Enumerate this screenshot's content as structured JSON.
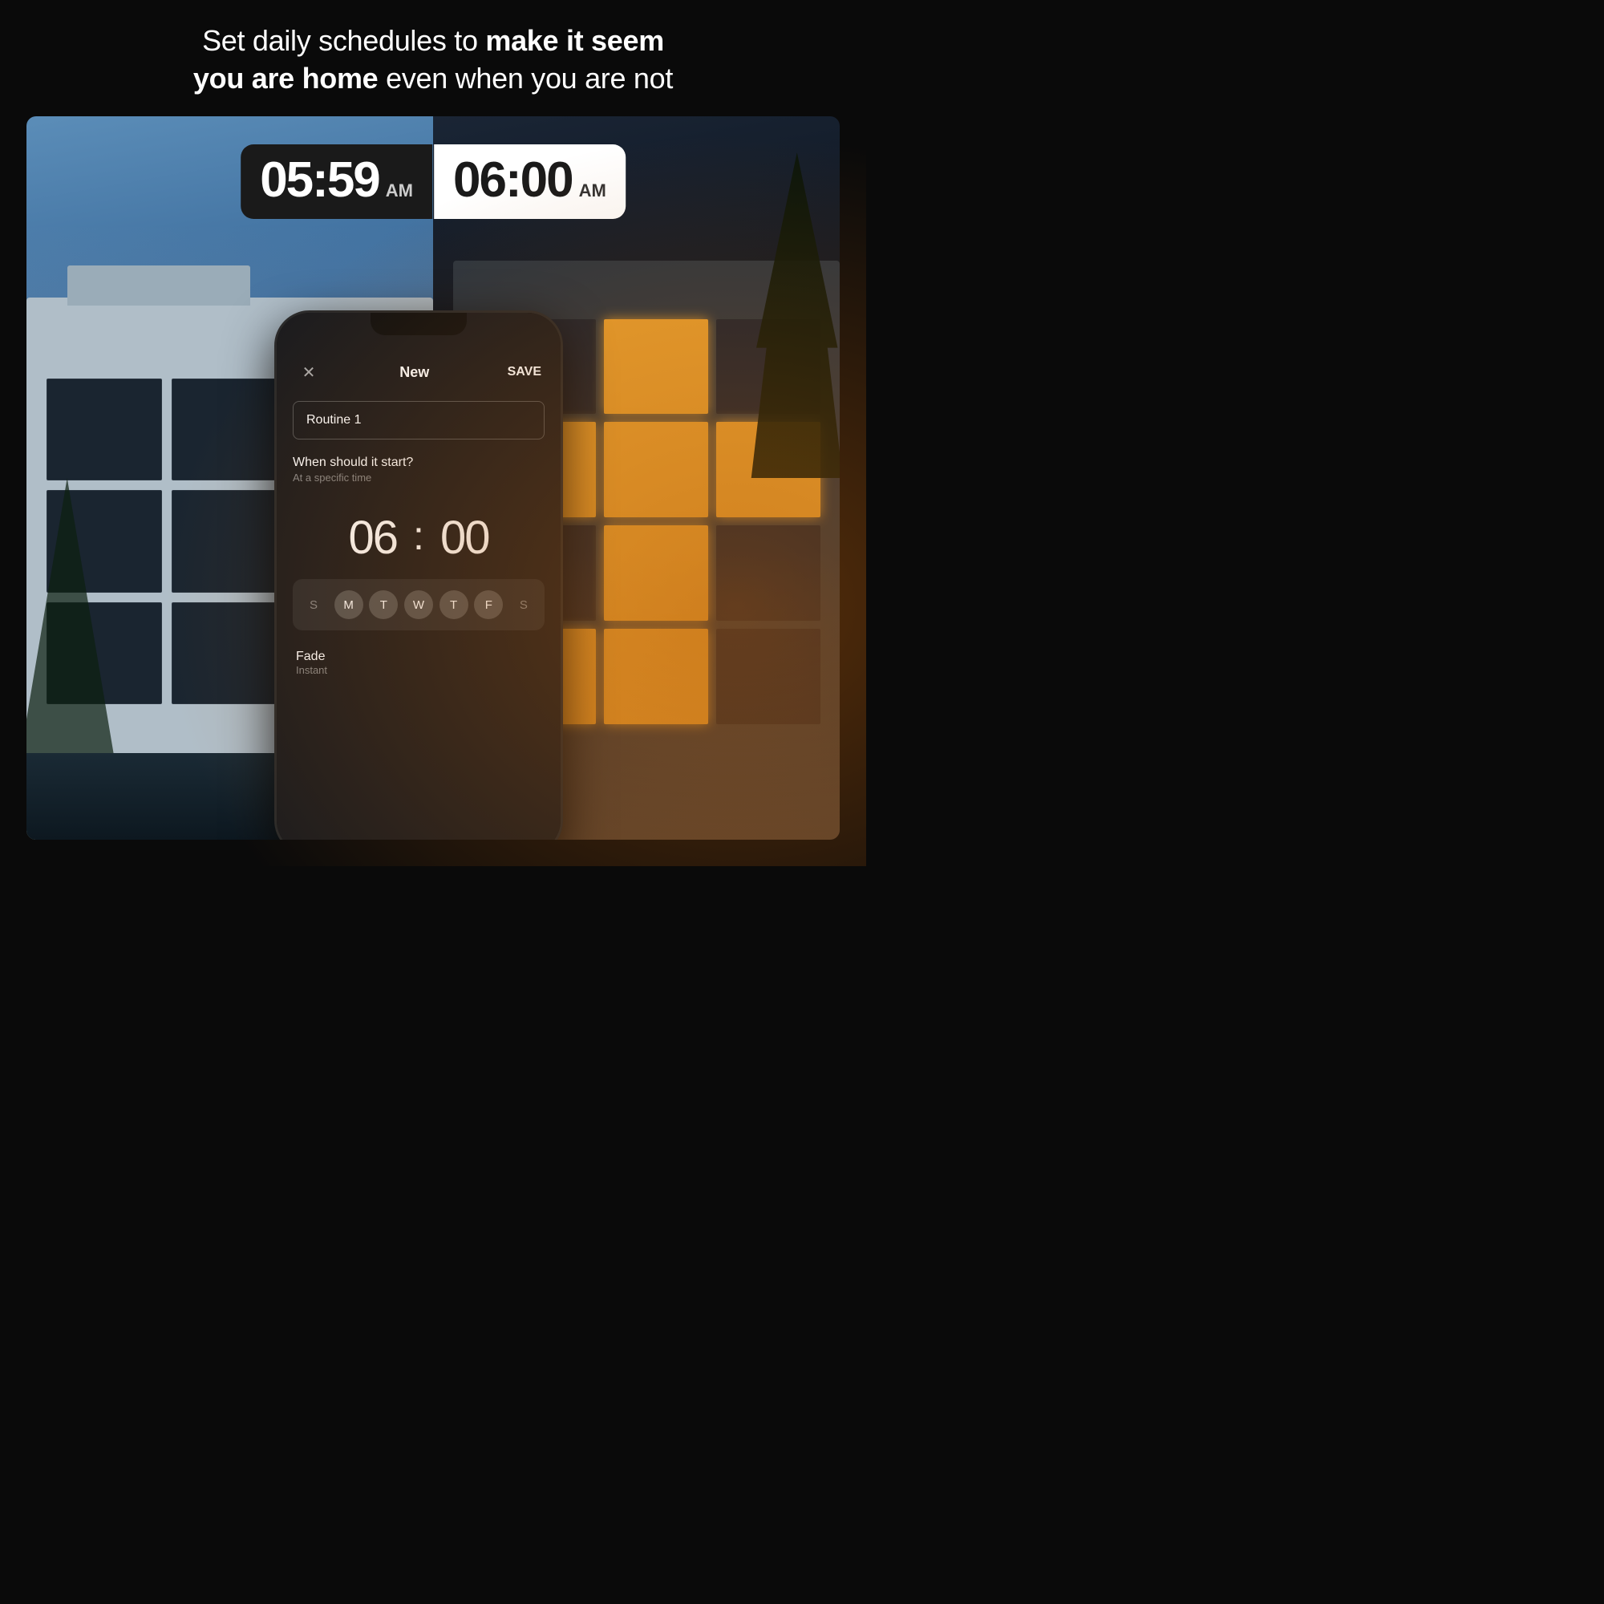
{
  "header": {
    "line1_normal": "Set daily schedules to ",
    "line1_bold": "make it seem",
    "line2_bold": "you are home",
    "line2_normal": " even when you are not"
  },
  "time_display": {
    "left_time": "05:59",
    "left_ampm": "AM",
    "right_time": "06:00",
    "right_ampm": "AM"
  },
  "phone": {
    "close_icon": "✕",
    "title": "New",
    "save_label": "SAVE",
    "input_placeholder": "Routine 1",
    "schedule_label": "When should it start?",
    "schedule_sublabel": "At a specific time",
    "time_hour": "06",
    "time_separator": ":",
    "time_minute": "00",
    "days": [
      {
        "label": "S",
        "selected": false
      },
      {
        "label": "M",
        "selected": true
      },
      {
        "label": "T",
        "selected": true
      },
      {
        "label": "W",
        "selected": true
      },
      {
        "label": "T",
        "selected": true
      },
      {
        "label": "F",
        "selected": true
      },
      {
        "label": "S",
        "selected": false
      }
    ],
    "fade_label": "Fade",
    "fade_sublabel": "Instant"
  }
}
